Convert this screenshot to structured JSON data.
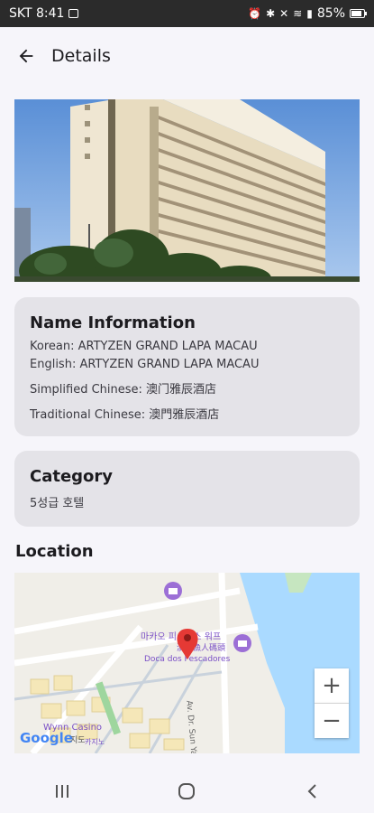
{
  "status": {
    "carrier_time": "SKT 8:41",
    "battery": "85%",
    "battery_level": 0.85
  },
  "appbar": {
    "title": "Details"
  },
  "name_info": {
    "title": "Name Information",
    "korean": "Korean: ARTYZEN GRAND LAPA MACAU",
    "english": "English: ARTYZEN GRAND LAPA MACAU",
    "simplified": "Simplified Chinese: 澳门雅辰酒店",
    "traditional": "Traditional Chinese: 澳門雅辰酒店"
  },
  "category": {
    "title": "Category",
    "value": "5성급 호텔"
  },
  "location": {
    "title": "Location",
    "map_labels": {
      "poi_name_ko": "마카오 피셔맨스 워프",
      "poi_name_cn": "澳門漁人碼頭",
      "poi_name_pt": "Doca dos Pescadores",
      "casino": "Wynn Casino",
      "casino_ko": "카지노",
      "street": "Av. Dr. Sun Yat-Sen",
      "brand": "Google",
      "brand_suffix": "지도"
    },
    "zoom_in": "+",
    "zoom_out": "−"
  },
  "colors": {
    "background": "#f6f5fa",
    "card": "#e4e3e8",
    "water": "#aadaff",
    "land": "#f0eee8",
    "marker": "#e53935"
  }
}
